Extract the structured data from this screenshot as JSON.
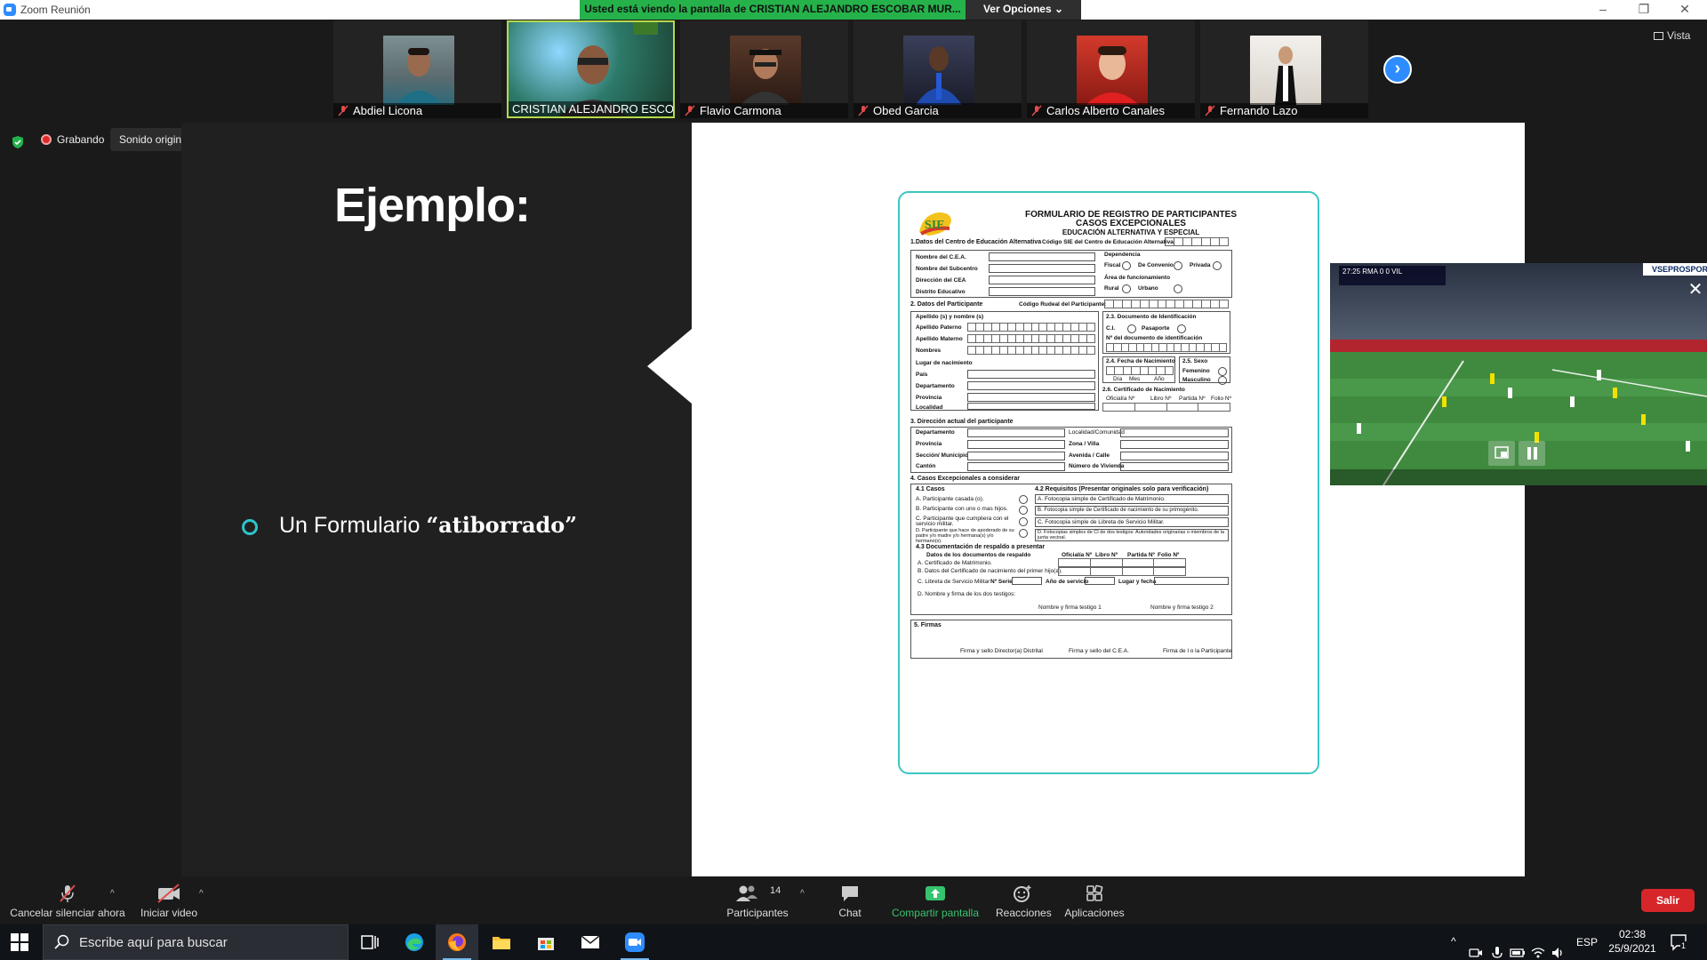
{
  "window": {
    "title": "Zoom Reunión",
    "banner": "Usted está viendo la pantalla de CRISTIAN ALEJANDRO ESCOBAR MUR...",
    "view_options": "Ver Opciones"
  },
  "participants": [
    {
      "name": "Abdiel Licona",
      "bg": "#5b6b6e"
    },
    {
      "name": "CRISTIAN ALEJANDRO ESCOB...",
      "bg": "#3b7a6a"
    },
    {
      "name": "Flavio Carmona",
      "bg": "#3a2a22"
    },
    {
      "name": "Obed Garcia",
      "bg": "#2b2f44"
    },
    {
      "name": "Carlos Alberto Canales",
      "bg": "#b3322b"
    },
    {
      "name": "Fernando Lazo",
      "bg": "#e9e4de"
    }
  ],
  "vista_label": "Vista",
  "recording": {
    "label": "Grabando",
    "sound": "Sonido original: desactivado"
  },
  "slide": {
    "title": "Ejemplo:",
    "bullet_prefix": "Un Formulario ",
    "bullet_bold": "“atiborrado”"
  },
  "form": {
    "title1": "FORMULARIO DE REGISTRO DE PARTICIPANTES",
    "title2": "CASOS EXCEPCIONALES",
    "title3": "EDUCACIÓN ALTERNATIVA Y ESPECIAL",
    "s1": "1.Datos del Centro de Educación Alternativa",
    "s1_code": "Código SIE del Centro de Educación Alternativa",
    "s1_fields": [
      "Nombre del C.E.A.",
      "Nombre del Subcentro",
      "Dirección del CEA",
      "Distrito Educativo"
    ],
    "dependencia": "Dependencia",
    "dep_opts": [
      "Fiscal",
      "De Convenio",
      "Privada"
    ],
    "area": "Área de funcionamiento",
    "area_opts": [
      "Rural",
      "Urbano"
    ],
    "s2": "2. Datos del Participante",
    "s2_code": "Código Rudeal del Participante:",
    "s2_name_header": "Apellido (s) y nombre (s)",
    "s2_names": [
      "Apellido Paterno",
      "Apellido Materno",
      "Nombres"
    ],
    "s2_doc": "2.3. Documento de Identificación",
    "s2_doc_opts": [
      "C.I.",
      "Pasaporte"
    ],
    "s2_doc_num": "Nº del documento de identificación",
    "s2_birth_header": "Lugar de nacimiento",
    "s2_birth": [
      "País",
      "Departamento",
      "Provincia",
      "Localidad"
    ],
    "s2_dob": "2.4. Fecha de Nacimiento",
    "s2_dob_parts": [
      "Día",
      "Mes",
      "Año"
    ],
    "s2_sex": "2.5. Sexo",
    "s2_sex_opts": [
      "Femenino",
      "Masculino"
    ],
    "s2_cert": "2.6. Certificado de Nacimiento",
    "s2_cert_cols": [
      "Oficialía Nº",
      "Libro Nº",
      "Partida Nº",
      "Folio Nº"
    ],
    "s3": "3. Dirección actual del participante",
    "s3_left": [
      "Departamento",
      "Provincia",
      "Sección/ Municipio",
      "Cantón"
    ],
    "s3_right": [
      "Localidad/Comunidad",
      "Zona / Villa",
      "Avenida / Calle",
      "Número de Vivienda"
    ],
    "s4": "4. Casos Excepcionales a considerar",
    "s41": "4.1 Casos",
    "s42": "4.2 Requisitos (Presentar originales solo para verificación)",
    "cases": [
      "A. Participante casada (o).",
      "B. Participante con uno o mas hijos.",
      "C. Participante que cumpliera con el servicio militar.",
      "D. Participante que hace de apoderado de su padre y/o madre y/o hermana(s) y/o hermano(s)."
    ],
    "reqs": [
      "A. Fotocopia simple de Certificado de Matrimonio.",
      "B. Fotocopia simple de Certificado de nacimiento de su primogénito.",
      "C. Fotocopia simple de Libreta de Servicio Militar.",
      "D. Fotocopias simples de CI de dos testigos: Autoridades originarias o miembros de la junta vecinal."
    ],
    "s43": "4.3 Documentación de respaldo a presentar",
    "s43_header": "Datos de los documentos de respaldo",
    "s43_cols": [
      "Oficialía Nº",
      "Libro Nº",
      "Partida Nº",
      "Folio Nº"
    ],
    "s43_rows": [
      "A. Certificado de Matrimonio.",
      "B. Datos del Certificado de nacimiento del primer hijo(a).",
      "C. Libreta de Servicio Militar"
    ],
    "s43_serie": "Nº Serie",
    "s43_year": "Año de servicio",
    "s43_place": "Lugar y fecha",
    "s43_d": "D. Nombre y firma de los dos testigos:",
    "witness1": "Nombre y firma testigo 1",
    "witness2": "Nombre y firma testigo 2",
    "s5": "5. Firmas",
    "sig": [
      "Firma y sello Director(a) Distrital",
      "Firma y sello del C.E.A.",
      "Firma de l o la Participante"
    ]
  },
  "video": {
    "tag": "VSEPROSPOR",
    "score": "27:25  RMA 0  0  VIL"
  },
  "controls": {
    "mute": "Cancelar silenciar ahora",
    "video": "Iniciar video",
    "participants": "Participantes",
    "participants_count": "14",
    "chat": "Chat",
    "share": "Compartir pantalla",
    "reactions": "Reacciones",
    "apps": "Aplicaciones",
    "leave": "Salir"
  },
  "taskbar": {
    "search_placeholder": "Escribe aquí para buscar",
    "lang": "ESP",
    "time": "02:38",
    "date": "25/9/2021",
    "notif_count": "1"
  }
}
